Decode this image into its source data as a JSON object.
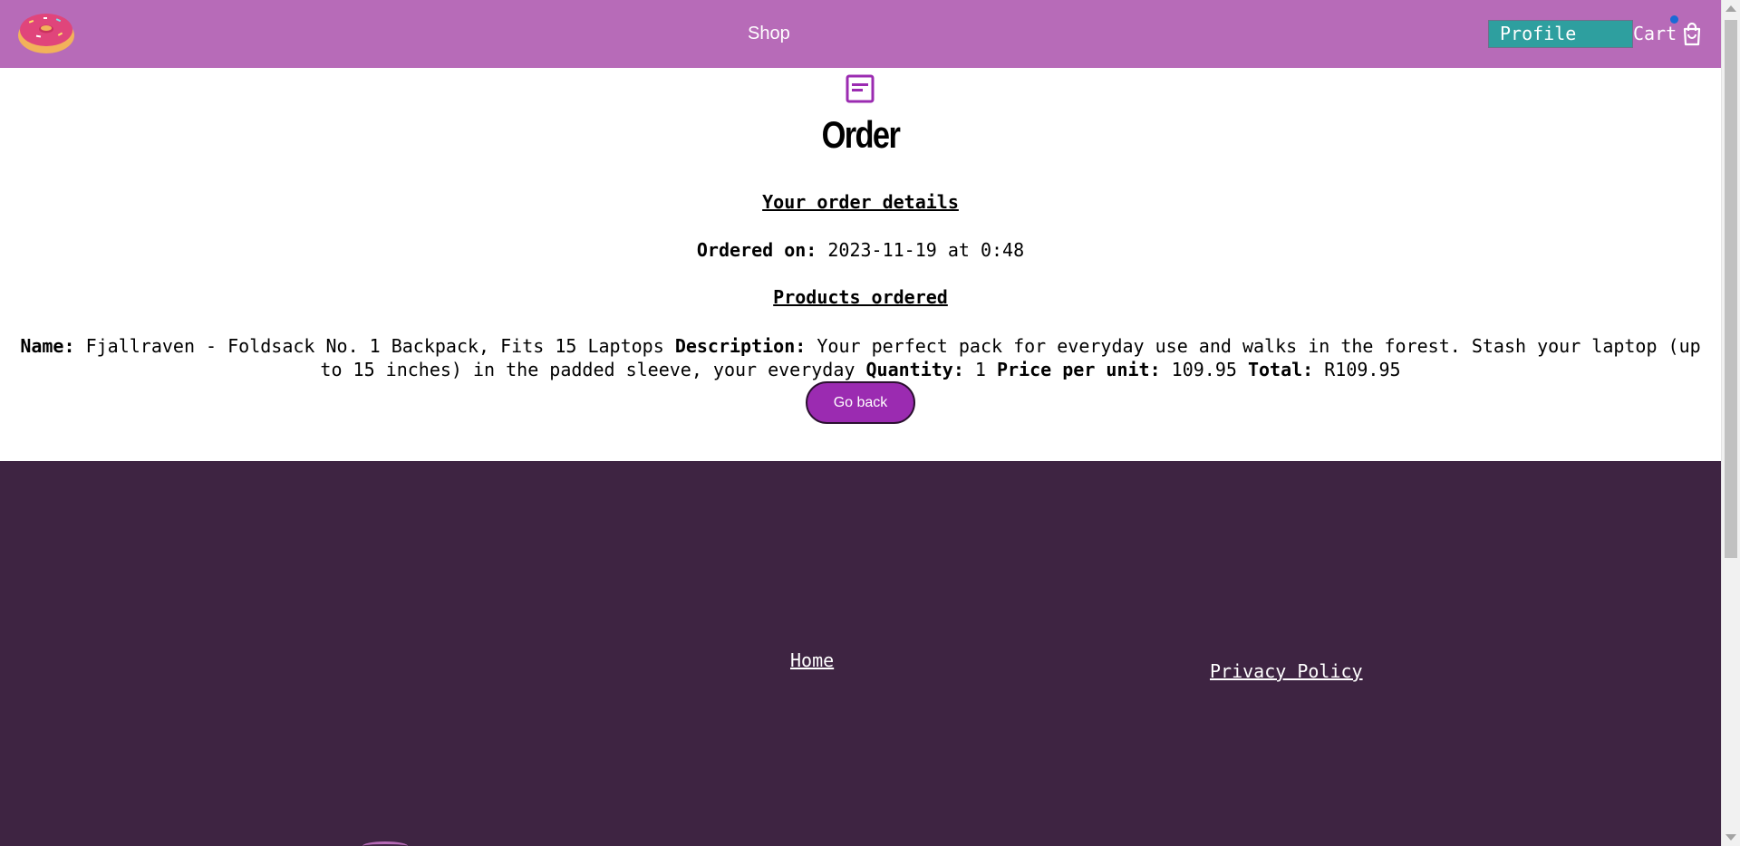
{
  "header": {
    "logo_icon": "donut-icon",
    "shop_label": "Shop",
    "profile_label": "Profile",
    "cart_label": "Cart",
    "cart_icon": "shopping-bag-icon",
    "colors": {
      "background": "#b76bb8",
      "profile_button": "#2e9f9f",
      "cart_badge": "#1a6ad6"
    }
  },
  "main": {
    "icon": "order-document-icon",
    "title": "Order",
    "details_heading": "Your order details",
    "ordered_on_label": "Ordered on:",
    "ordered_on_value": "2023-11-19 at 0:48",
    "products_heading": "Products ordered",
    "product": {
      "name_label": "Name:",
      "name": "Fjallraven - Foldsack No. 1 Backpack, Fits 15 Laptops",
      "description_label": "Description:",
      "description": "Your perfect pack for everyday use and walks in the forest. Stash your laptop (up to 15 inches) in the padded sleeve, your everyday",
      "quantity_label": "Quantity:",
      "quantity": "1",
      "price_label": "Price per unit:",
      "price": "109.95",
      "total_label": "Total:",
      "total": "R109.95"
    },
    "go_back_label": "Go back",
    "colors": {
      "accent": "#9b2bb1"
    }
  },
  "footer": {
    "home_label": "Home",
    "privacy_label": "Privacy Policy",
    "colors": {
      "background": "#3e2442"
    }
  }
}
